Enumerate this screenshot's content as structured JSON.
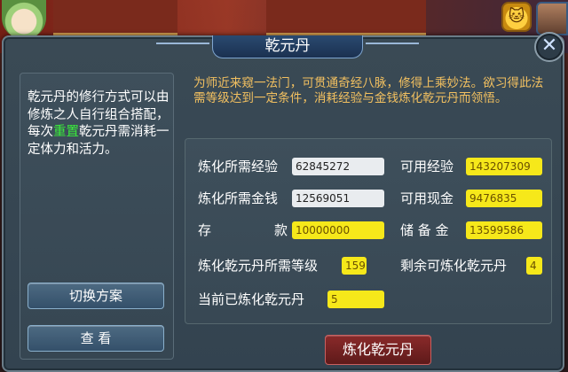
{
  "header": {
    "cat_icon": "cat-face-icon"
  },
  "dialog": {
    "title": "乾元丹",
    "close_glyph": "✕",
    "description_parts": [
      "乾元丹的修行方式可以由修炼之人自行组合搭配，每次",
      "重置",
      "乾元丹需消耗一定体力和活力。"
    ],
    "switch_plan_label": "切换方案",
    "view_label": "查 看",
    "intro_text": "为师近来窥一法门，可贯通奇经八脉，修得上乘妙法。欲习得此法需等级达到一定条件，消耗经验与金钱炼化乾元丹而领悟。",
    "stats": {
      "exp_required_label": "炼化所需经验",
      "exp_required_value": "62845272",
      "exp_available_label": "可用经验",
      "exp_available_value": "143207309",
      "money_required_label": "炼化所需金钱",
      "money_required_value": "12569051",
      "cash_available_label": "可用现金",
      "cash_available_value": "9476835",
      "deposit_label_a": "存",
      "deposit_label_b": "款",
      "deposit_value": "10000000",
      "reserve_label": "储 备 金",
      "reserve_value": "13599586",
      "level_required_label": "炼化乾元丹所需等级",
      "level_required_value": "159",
      "remaining_label": "剩余可炼化乾元丹",
      "remaining_value": "4",
      "current_label": "当前已炼化乾元丹",
      "current_value": "5"
    },
    "refine_button_label": "炼化乾元丹"
  },
  "colors": {
    "highlight": "#3af03a",
    "intro_text": "#f2c060",
    "yellow_field": "#f6e81a"
  }
}
